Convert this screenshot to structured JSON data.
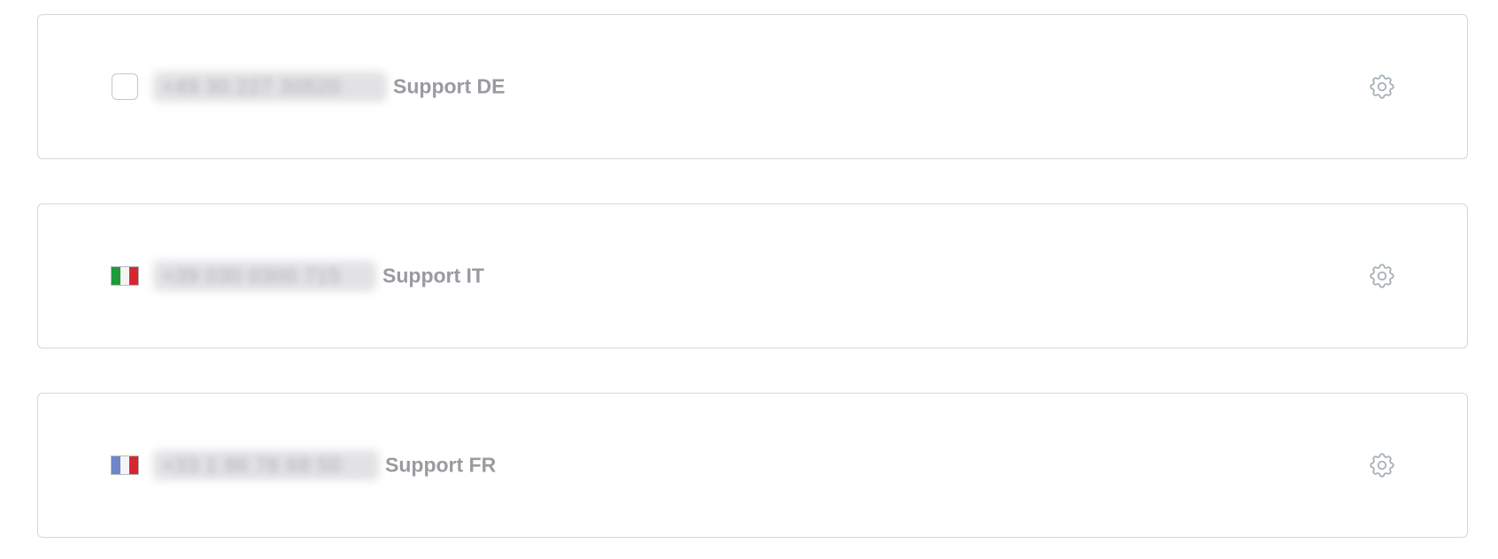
{
  "lines": [
    {
      "leading": "checkbox",
      "phone": "+49 30 227 30520",
      "label": "Support DE",
      "settings_icon": "gear-icon"
    },
    {
      "leading": "flag",
      "flag_country": "IT",
      "flag_colors": [
        "#1f9a3a",
        "#f4f4f4",
        "#d8262e"
      ],
      "phone": "+39 030 0300 715",
      "label": "Support IT",
      "settings_icon": "gear-icon"
    },
    {
      "leading": "flag",
      "flag_country": "FR",
      "flag_colors": [
        "#6f86c8",
        "#f4f4f4",
        "#d8262e"
      ],
      "phone": "+33 1 86 76 68 50",
      "label": "Support FR",
      "settings_icon": "gear-icon"
    }
  ],
  "colors": {
    "card_border": "#d6d6d9",
    "label_text": "#9a9aa0",
    "icon": "#a7b1b8"
  }
}
